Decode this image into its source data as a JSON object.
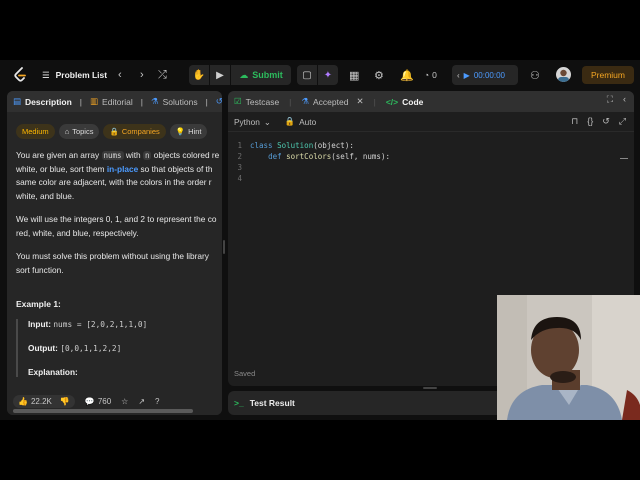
{
  "nav": {
    "title": "Problem List",
    "submit_label": "Submit",
    "streak": "0",
    "timer": "00:00:00",
    "premium_label": "Premium"
  },
  "left_tabs": [
    "Description",
    "Editorial",
    "Solutions",
    "S"
  ],
  "chips": {
    "difficulty": "Medium",
    "topics": "Topics",
    "companies": "Companies",
    "hint": "Hint"
  },
  "description": {
    "p1_a": "You are given an array ",
    "p1_code1": "nums",
    "p1_b": " with ",
    "p1_code2": "n",
    "p1_c": " objects colored re",
    "p1_line2_a": "white, or blue, sort them ",
    "p1_line2_hl": "in-place",
    "p1_line2_b": " so that objects of th",
    "p1_line3": "same color are adjacent, with the colors in the order r",
    "p1_line4": "white, and blue.",
    "p2_line1": "We will use the integers 0, 1, and 2 to represent the co",
    "p2_line2": "red, white, and blue, respectively.",
    "p3_line1": "You must solve this problem without using the library",
    "p3_line2": "sort function."
  },
  "example": {
    "title": "Example 1:",
    "input_label": "Input:",
    "input_value": "nums = [2,0,2,1,1,0]",
    "output_label": "Output:",
    "output_value": "[0,0,1,1,2,2]",
    "explanation_label": "Explanation:"
  },
  "footer": {
    "likes": "22.2K",
    "comments": "760"
  },
  "editor_tabs": {
    "testcase": "Testcase",
    "accepted": "Accepted",
    "code": "Code"
  },
  "editor": {
    "language": "Python",
    "mode": "Auto",
    "line_numbers": [
      "1",
      "2",
      "3",
      "4"
    ],
    "line1_kw": "class",
    "line1_cls": "Solution",
    "line1_rest": "(object):",
    "line2_kw": "def",
    "line2_fn": "sortColors",
    "line2_rest": "(self, nums):",
    "status": "Saved"
  },
  "result": {
    "label": "Test Result"
  }
}
